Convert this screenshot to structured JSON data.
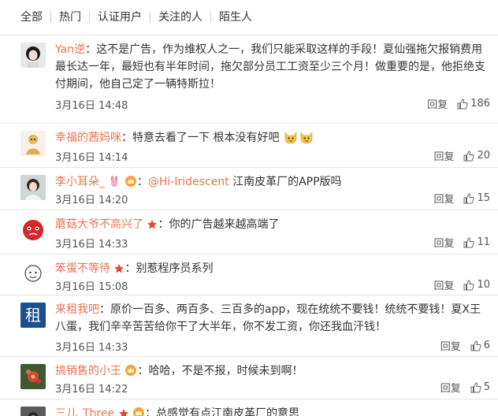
{
  "tabs": [
    "全部",
    "热门",
    "认证用户",
    "关注的人",
    "陌生人"
  ],
  "reply_label": "回复",
  "colors": {
    "username": "#eb7350",
    "text": "#333333",
    "meta": "#555555",
    "divider": "#e6e6e6"
  },
  "comments": [
    {
      "user": "Yan逆",
      "text": "：这不是广告，作为维权人之一，我们只能采取这样的手段！夏仙强拖欠报销费用最长达一年，最短也有半年时间，拖欠部分员工工资至少三个月！做重要的是，他拒绝支付期间，他自己定了一辆特斯拉！",
      "time": "3月16日 14:48",
      "likes": "186",
      "avatar_icon": "woman-portrait-icon"
    },
    {
      "user": "幸福的茜妈咪",
      "text": "：特意去看了一下 根本没有好吧",
      "time": "3月16日 14:14",
      "likes": "20",
      "avatar_icon": "cartoon-girl-icon",
      "emojis": [
        "cat-face-emoji",
        "cat-face-emoji"
      ]
    },
    {
      "user": "李小耳朵_",
      "pre": "：",
      "mention": "@Hi-Iridescent",
      "text": " 江南皮革厂的APP版吗",
      "time": "3月16日 14:20",
      "likes": "15",
      "avatar_icon": "girl-photo-icon",
      "badges": [
        "bunny-badge-icon",
        "crown-badge-icon"
      ]
    },
    {
      "user": "蘑菇大爷不高兴了",
      "text": "：你的广告越来越高端了",
      "time": "3月16日 14:33",
      "likes": "11",
      "avatar_icon": "red-cartoon-icon",
      "badges": [
        "star-badge-icon"
      ]
    },
    {
      "user": "笨蛋不等待",
      "text": "：别惹程序员系列",
      "time": "3月16日 15:08",
      "likes": "10",
      "avatar_icon": "sketch-face-icon",
      "badges": [
        "star-badge-icon"
      ]
    },
    {
      "user": "来租我吧",
      "text": "：原价一百多、两百多、三百多的app，现在统统不要钱！统统不要钱！夏X王八蛋，我们辛辛苦苦给你干了大半年，你不发工资，你还我血汗钱！",
      "time": "3月16日 14:33",
      "likes": "6",
      "avatar_icon": "zu-character-logo-icon",
      "avatar_text": "租"
    },
    {
      "user": "搞销售的小王",
      "text": "：哈哈，不是不报，时候未到啊！",
      "time": "3月16日 14:22",
      "likes": "5",
      "avatar_icon": "flower-photo-icon",
      "badges": [
        "crown-badge-icon"
      ]
    },
    {
      "user": "三儿_Three",
      "text": "：总感觉有点江南皮革厂的意思",
      "time": "",
      "likes": "",
      "avatar_icon": "dark-photo-icon",
      "badges": [
        "star-badge-icon",
        "crown-badge-icon"
      ]
    }
  ]
}
